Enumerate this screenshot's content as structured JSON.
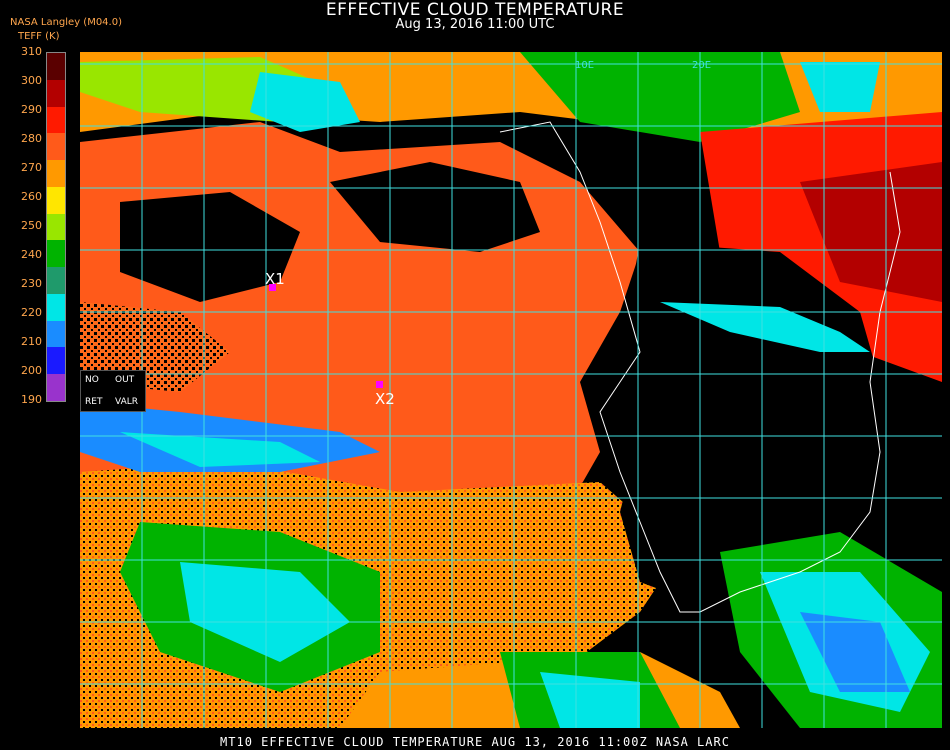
{
  "header": {
    "title": "EFFECTIVE CLOUD TEMPERATURE",
    "subtitle": "Aug 13, 2016 11:00 UTC",
    "badge": "NASA Langley (M04.0)",
    "unit_label": "TEFF (K)"
  },
  "colorbar": {
    "ticks": [
      "310",
      "300",
      "290",
      "280",
      "270",
      "260",
      "250",
      "240",
      "230",
      "220",
      "210",
      "200",
      "190"
    ],
    "colors": [
      "#5a0000",
      "#b30000",
      "#ff1a00",
      "#ff5a1a",
      "#ff9900",
      "#ffe600",
      "#99e600",
      "#00b300",
      "#1f9a6b",
      "#00e6e6",
      "#1a8cff",
      "#1a1aff",
      "#9933cc"
    ]
  },
  "legend": {
    "no_label": "NO",
    "out_label": "OUT",
    "ret_label": "RET",
    "valr_label": "VALR"
  },
  "map": {
    "grid_labels": [
      "10E",
      "20E"
    ],
    "markers": [
      {
        "label": "X1",
        "color": "#ff00ff"
      },
      {
        "label": "X2",
        "color": "#ff00ff"
      }
    ],
    "grid_color": "#40e0e0"
  },
  "footer": {
    "text": "MT10  EFFECTIVE CLOUD TEMPERATURE   AUG 13, 2016 11:00Z   NASA LARC"
  }
}
